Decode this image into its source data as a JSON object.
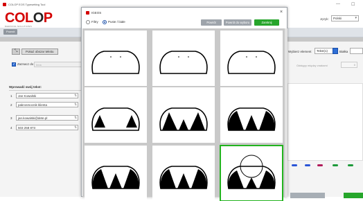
{
  "app": {
    "title": "COLOP EOS Typesetting Tool",
    "min_glyph": "—",
    "max_glyph": "☐",
    "brand_prefix": "COL",
    "brand_o": "O",
    "brand_suffix": "P",
    "brand_tagline": "MARKING SOLUTIONS",
    "language_label": "Język:",
    "language_value": "Polski",
    "back_label": "Powrót"
  },
  "left_panel": {
    "resize_glyph": "⤡",
    "insert_text_label": "Pokaż obszar tekstu",
    "mark_all_label": "Zaznacz do wszystkiego",
    "mark_all_checked_glyph": "✓",
    "mark_all_value": "Inna",
    "enter_text_title": "Wprowadź swój tekst:",
    "rows": [
      {
        "num": "1",
        "text": "Jan Kowalski"
      },
      {
        "num": "2",
        "text": "pakrosmocnik klienta"
      },
      {
        "num": "3",
        "text": "jan.kowalski@dete.pl"
      },
      {
        "num": "4",
        "text": "503 258 873"
      }
    ],
    "row_tool_glyph": "⇅"
  },
  "right_panel": {
    "element_label": "Wybierz element",
    "element_value": "Tekst(1)",
    "font_label": "Białka",
    "spacing_label": "Odstępy między znakami",
    "spacing_value": "0",
    "color_dots": [
      "#2a55d6",
      "#2a55d6",
      "#b01a5a",
      "#1d9a3a",
      "#1d9a3a"
    ]
  },
  "modal": {
    "title": "IGEOS",
    "close_glyph": "×",
    "radio_filters_label": "Filtry",
    "radio_empty_label": "Puste / białe",
    "btn_back": "Powrót",
    "btn_back_to_choice": "Powrót do wyboru",
    "btn_close": "Zamknij",
    "selected_tile": 8,
    "tiles": [
      {
        "icon": "outline-frame"
      },
      {
        "icon": "outline-frame"
      },
      {
        "icon": "outline-frame"
      },
      {
        "icon": "partial-corner-frame"
      },
      {
        "icon": "partial-dark-frame"
      },
      {
        "icon": "filled-corner-frame"
      },
      {
        "icon": "filled-corner-frame"
      },
      {
        "icon": "filled-corner-frame"
      },
      {
        "icon": "filled-frame-with-circle"
      }
    ]
  }
}
